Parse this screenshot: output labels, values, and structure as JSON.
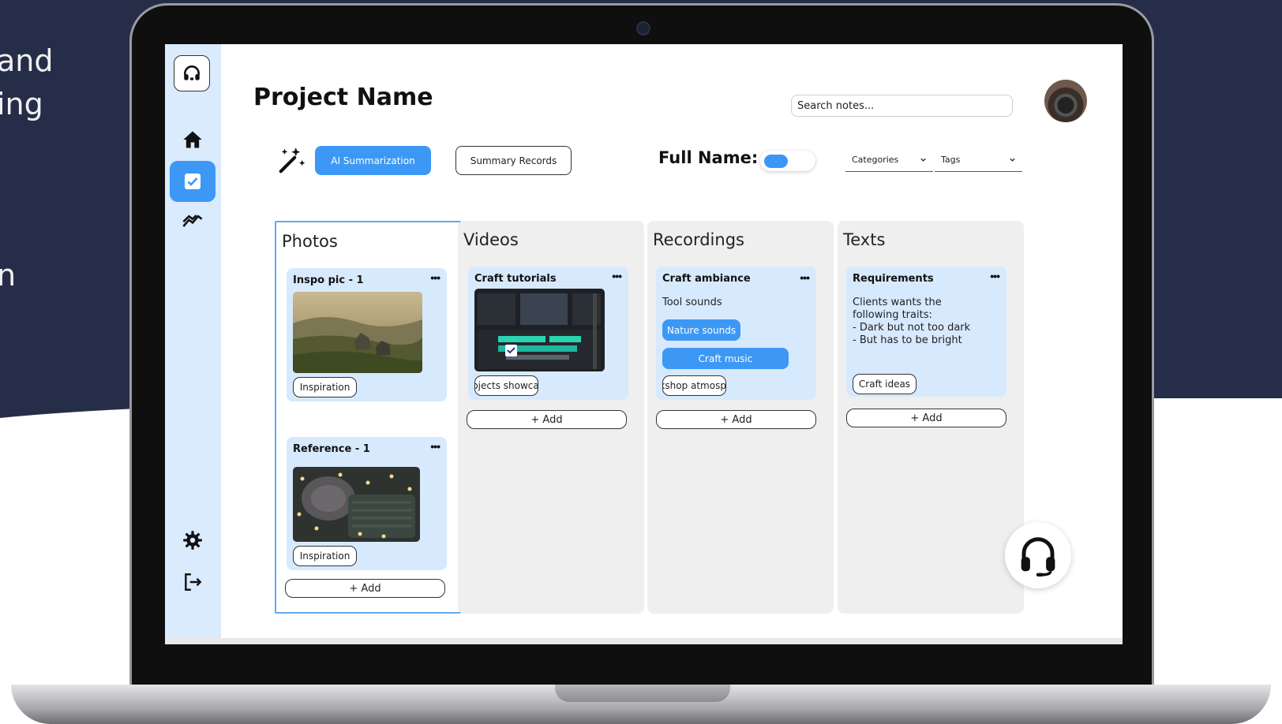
{
  "background": {
    "side_text": [
      "and",
      "ing",
      "n"
    ],
    "color": "#262d49"
  },
  "sidebar": {
    "items": [
      {
        "name": "home",
        "icon": "home-icon",
        "active": false
      },
      {
        "name": "tasks",
        "icon": "checkbox-icon",
        "active": true
      },
      {
        "name": "analytics",
        "icon": "trend-icon",
        "active": false
      }
    ],
    "bottom_items": [
      {
        "name": "settings",
        "icon": "gear-icon"
      },
      {
        "name": "logout",
        "icon": "logout-icon"
      }
    ]
  },
  "header": {
    "title": "Project Name",
    "search_placeholder": "Search notes..."
  },
  "toolbar": {
    "ai_label": "AI Summarization",
    "records_label": "Summary Records",
    "fullname_label": "Full Name:",
    "toggle_on": true,
    "categories_label": "Categories",
    "tags_label": "Tags"
  },
  "columns": {
    "photos": {
      "title": "Photos",
      "cards": [
        {
          "title": "Inspo pic - 1",
          "tag": "Inspiration"
        },
        {
          "title": "Reference - 1",
          "tag": "Inspiration"
        }
      ],
      "add_label": "+ Add"
    },
    "videos": {
      "title": "Videos",
      "cards": [
        {
          "title": "Craft tutorials",
          "tag": "Projects showcase"
        }
      ],
      "add_label": "+ Add"
    },
    "recordings": {
      "title": "Recordings",
      "cards": [
        {
          "title": "Craft ambiance",
          "line": "Tool sounds",
          "chips": [
            "Nature sounds",
            "Craft music"
          ],
          "tag": "Workshop atmosphere"
        }
      ],
      "add_label": "+ Add"
    },
    "texts": {
      "title": "Texts",
      "cards": [
        {
          "title": "Requirements",
          "lines": [
            "Clients wants the",
            "following traits:",
            "- Dark but not too dark",
            "- But has to be bright"
          ],
          "tag": "Craft ideas"
        }
      ],
      "add_label": "+ Add"
    }
  },
  "menu_label": "•••",
  "colors": {
    "accent": "#3d98f5",
    "sidebar": "#d9ebfd",
    "card": "#d7e9fd",
    "column": "#efefef",
    "selected_border": "#62a9ee"
  }
}
